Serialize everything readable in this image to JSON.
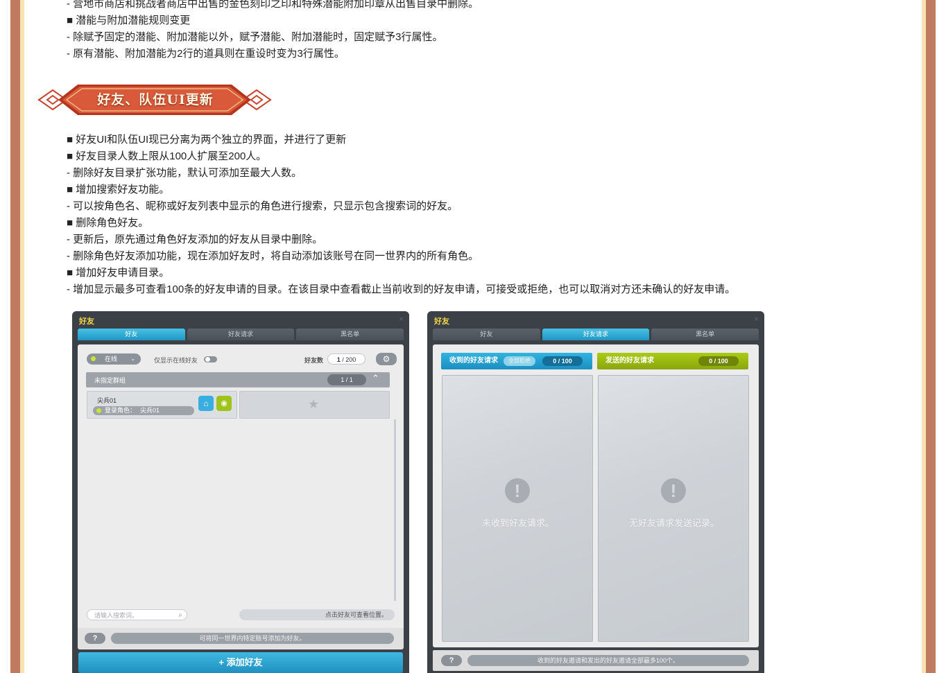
{
  "intro_lines": [
    "- 营地市商店和挑战者商店中出售的金色刻印之印和特殊潜能附加印章从出售目录中删除。",
    "■ 潜能与附加潜能规则变更",
    "- 除赋予固定的潜能、附加潜能以外，赋予潜能、附加潜能时，固定赋予3行属性。",
    "- 原有潜能、附加潜能为2行的道具则在重设时变为3行属性。"
  ],
  "section": {
    "title": "好友、队伍UI更新"
  },
  "section_lines": [
    "■ 好友UI和队伍UI现已分离为两个独立的界面，并进行了更新",
    "■ 好友目录人数上限从100人扩展至200人。",
    "- 删除好友目录扩张功能，默认可添加至最大人数。",
    "■ 增加搜索好友功能。",
    "- 可以按角色名、昵称或好友列表中显示的角色进行搜索，只显示包含搜索词的好友。",
    "■ 删除角色好友。",
    "- 更新后，原先通过角色好友添加的好友从目录中删除。",
    "- 删除角色好友添加功能，现在添加好友时，将自动添加该账号在同一世界内的所有角色。",
    "■ 增加好友申请目录。",
    "- 增加显示最多可查看100条的好友申请的目录。在该目录中查看截止当前收到的好友申请，可接受或拒绝，也可以取消对方还未确认的好友申请。"
  ],
  "friend_window": {
    "title": "好友",
    "close": "×",
    "tabs": [
      "好友",
      "好友请求",
      "黑名单"
    ],
    "status": "在线",
    "online_only_label": "仅显示在线好友",
    "friend_count_label": "好友数",
    "friend_count": "1",
    "friend_max": "200",
    "group_name": "未指定群组",
    "group_count": "1 / 1",
    "friend_name": "尖兵01",
    "login_role_label": "登录角色：",
    "login_role": "尖兵01",
    "search_placeholder": "请输入搜索词。",
    "click_hint": "点击好友可查看位置。",
    "help": "?",
    "help_msg": "可将同一世界内特定账号添加为好友。",
    "add_button": "+ 添加好友"
  },
  "request_window": {
    "title": "好友",
    "close": "×",
    "tabs": [
      "好友",
      "好友请求",
      "黑名单"
    ],
    "received_title": "收到的好友请求",
    "reject_all": "全部拒绝",
    "received_count": "0 / 100",
    "sent_title": "发送的好友请求",
    "sent_count": "0 / 100",
    "empty_received": "未收到好友请求。",
    "empty_sent": "无好友请求发送记录。",
    "help": "?",
    "help_msg": "收到的好友邀请和发出的好友邀请全部最多100个。"
  },
  "colors": {
    "frame": "#c07a60",
    "banner_red": "#c9432a",
    "tab_active": "#2aa6d2",
    "received_header": "#1f9fcd",
    "sent_header": "#9ab80f"
  }
}
